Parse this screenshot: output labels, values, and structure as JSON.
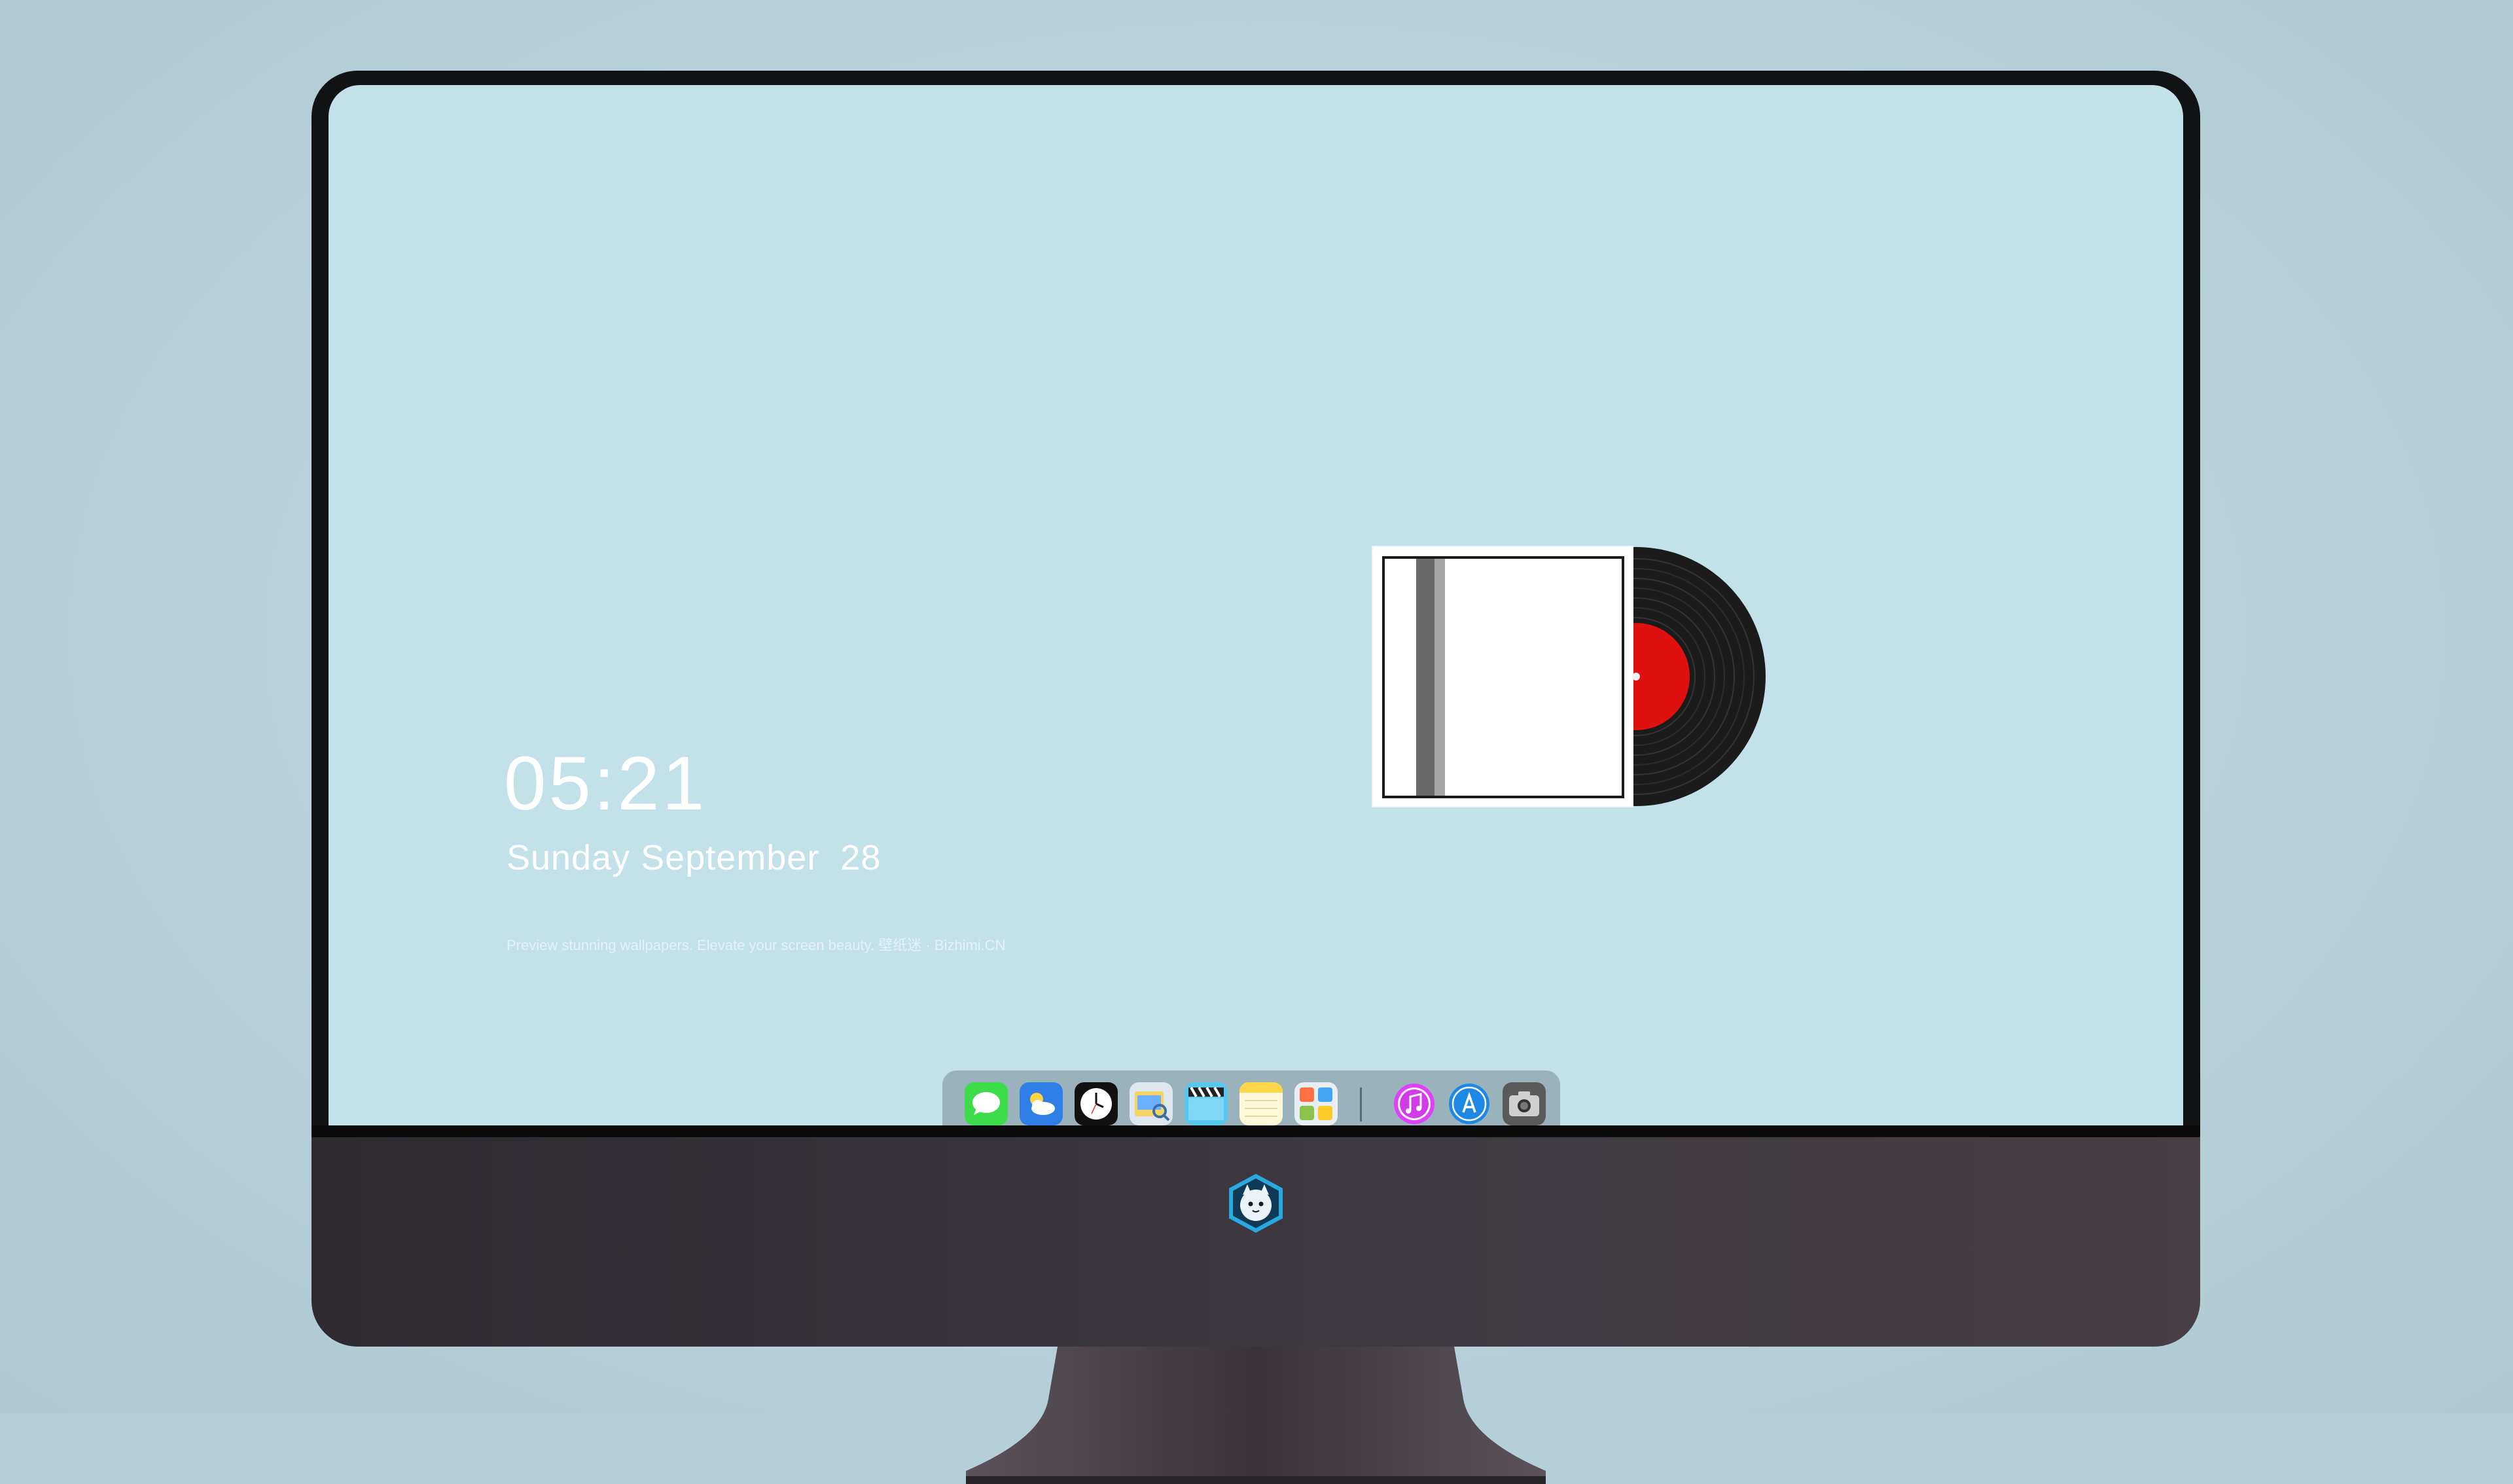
{
  "lockscreen": {
    "time": "05:21",
    "date": "Sunday September  28",
    "tagline": "Preview stunning wallpapers. Elevate your screen beauty. 壁纸迷 · Bizhimi.CN"
  },
  "dock": {
    "apps": [
      {
        "name": "messages-icon",
        "color": "#3ddc4a"
      },
      {
        "name": "weather-icon",
        "color": "#3a8ef0"
      },
      {
        "name": "clock-icon",
        "color": "#ffffff"
      },
      {
        "name": "preview-icon",
        "color": "#e9c46a"
      },
      {
        "name": "clapper-icon",
        "color": "#4fc3ec"
      },
      {
        "name": "notes-icon",
        "color": "#ffd54a"
      },
      {
        "name": "photos-folder-icon",
        "color": "#8bc34a"
      },
      {
        "name": "itunes-icon",
        "color": "#e040fb"
      },
      {
        "name": "app-store-icon",
        "color": "#2196f3"
      },
      {
        "name": "camera-icon",
        "color": "#4a4a4a"
      }
    ]
  },
  "colors": {
    "screen_bg": "#c3e1e9",
    "record_label": "#e01010",
    "vinyl": "#1b1b1b"
  }
}
